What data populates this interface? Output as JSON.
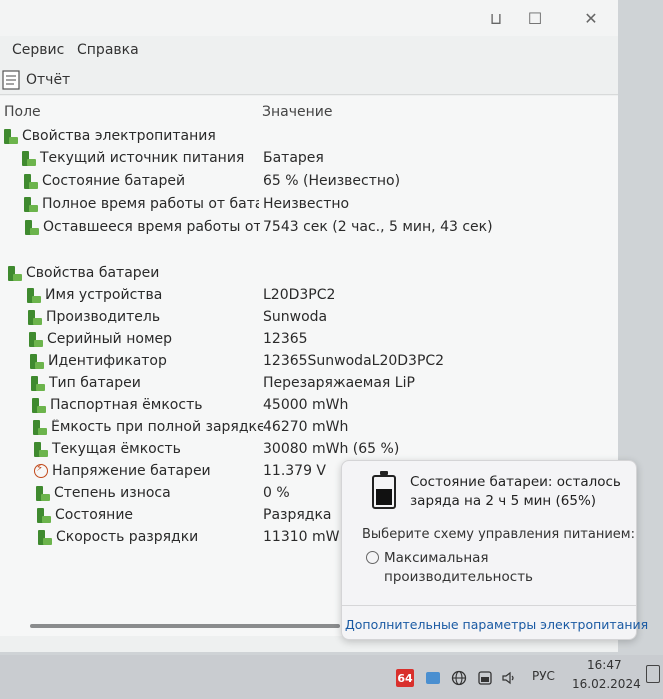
{
  "window": {
    "title_controls": {
      "minimize": "⊔",
      "maximize": "☐",
      "close": "✕"
    }
  },
  "menu": {
    "service": "Сервис",
    "help": "Справка"
  },
  "toolbar": {
    "report": "Отчёт"
  },
  "table": {
    "col_field": "Поле",
    "col_value": "Значение",
    "group_power": "Свойства электропитания",
    "power_rows": [
      {
        "field": "Текущий источник питания",
        "value": "Батарея"
      },
      {
        "field": "Состояние батарей",
        "value": "65 % (Неизвестно)"
      },
      {
        "field": "Полное время работы от бата...",
        "value": "Неизвестно"
      },
      {
        "field": "Оставшееся время работы от ...",
        "value": "7543 сек (2 час., 5 мин, 43 сек)"
      }
    ],
    "group_battery": "Свойства батареи",
    "battery_rows": [
      {
        "field": "Имя устройства",
        "value": "L20D3PC2"
      },
      {
        "field": "Производитель",
        "value": "Sunwoda"
      },
      {
        "field": "Серийный номер",
        "value": "12365"
      },
      {
        "field": "Идентификатор",
        "value": "12365SunwodaL20D3PC2"
      },
      {
        "field": "Тип батареи",
        "value": "Перезаряжаемая LiP"
      },
      {
        "field": "Паспортная ёмкость",
        "value": "45000 mWh"
      },
      {
        "field": "Ёмкость при полной зарядке",
        "value": "46270 mWh"
      },
      {
        "field": "Текущая ёмкость",
        "value": "30080 mWh  (65 %)"
      },
      {
        "field": "Напряжение батареи",
        "value": "11.379 V"
      },
      {
        "field": "Степень износа",
        "value": "0 %"
      },
      {
        "field": "Состояние",
        "value": "Разрядка"
      },
      {
        "field": "Скорость разрядки",
        "value": "11310 mW"
      }
    ]
  },
  "popup": {
    "status": "Состояние батареи: осталось заряда на 2 ч 5 мин (65%)",
    "scheme_prompt": "Выберите схему управления питанием:",
    "scheme_option": "Максимальная производительность",
    "link": "Дополнительные параметры электропитания"
  },
  "taskbar": {
    "badge": "64",
    "lang": "РУС",
    "time": "16:47",
    "date": "16.02.2024"
  }
}
